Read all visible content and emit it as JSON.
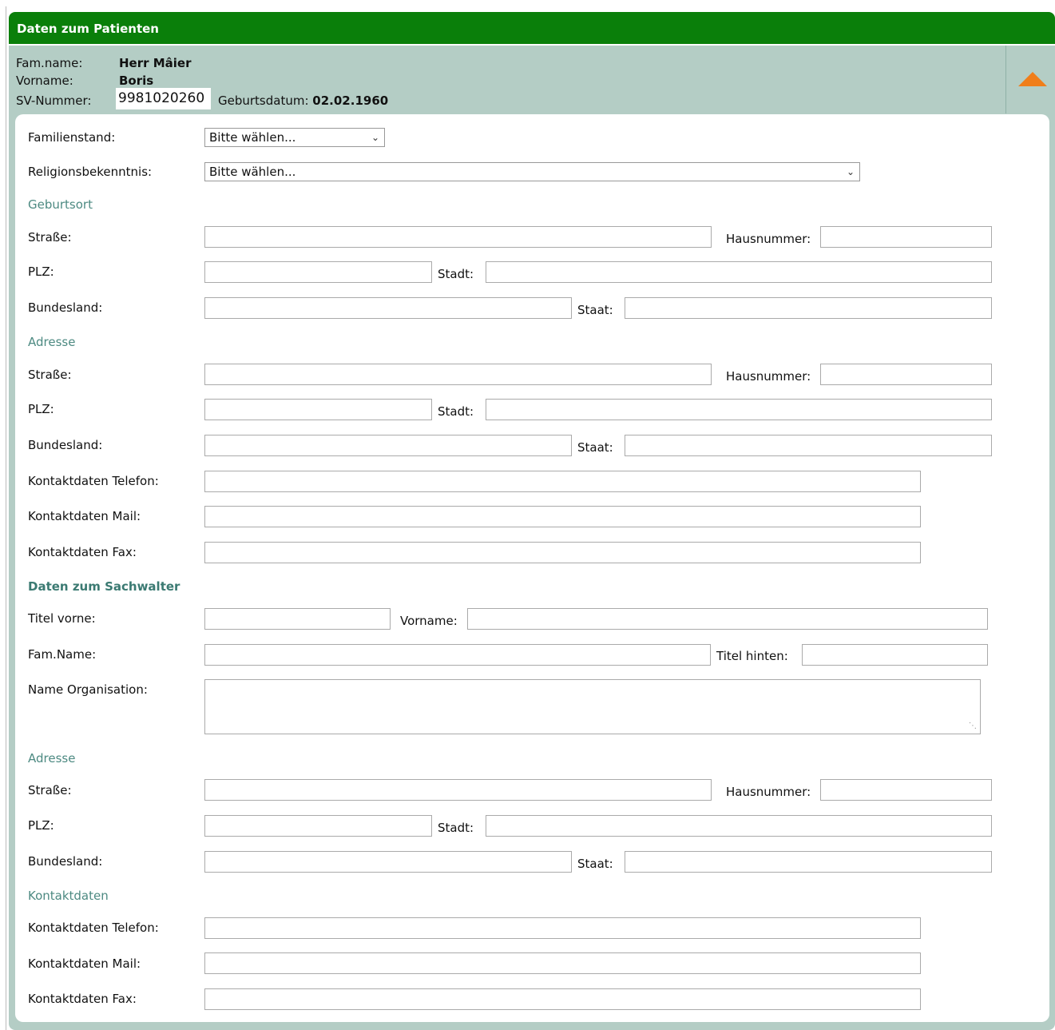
{
  "header": {
    "title": "Daten zum Patienten"
  },
  "patient": {
    "famname_label": "Fam.name:",
    "famname_value": "Herr Mâier",
    "vorname_label": "Vorname:",
    "vorname_value": "Boris",
    "sv_label": "SV-Nummer:",
    "sv_value": "9981020260",
    "geburt_label": "Geburtsdatum:",
    "geburt_value": "02.02.1960"
  },
  "form": {
    "familienstand_label": "Familienstand:",
    "familienstand_value": "Bitte wählen...",
    "religion_label": "Religionsbekenntnis:",
    "religion_value": "Bitte wählen...",
    "geburtsort_section": "Geburtsort",
    "adresse_section": "Adresse",
    "sachwalter_section": "Daten zum Sachwalter",
    "kontaktdaten_section": "Kontaktdaten",
    "strasse_label": "Straße:",
    "hausnummer_label": "Hausnummer:",
    "plz_label": "PLZ:",
    "stadt_label": "Stadt:",
    "bundesland_label": "Bundesland:",
    "staat_label": "Staat:",
    "telefon_label": "Kontaktdaten Telefon:",
    "mail_label": "Kontaktdaten Mail:",
    "fax_label": "Kontaktdaten Fax:",
    "titel_vorne_label": "Titel vorne:",
    "vorname_label": "Vorname:",
    "famname_label": "Fam.Name:",
    "titel_hinten_label": "Titel hinten:",
    "organisation_label": "Name Organisation:"
  },
  "colors": {
    "header": "#0a7f0a",
    "panel": "#b4cdc5",
    "accent": "#f07e1a",
    "section": "#4d8a82"
  },
  "icons": {
    "collapse": "triangle-up-icon"
  }
}
